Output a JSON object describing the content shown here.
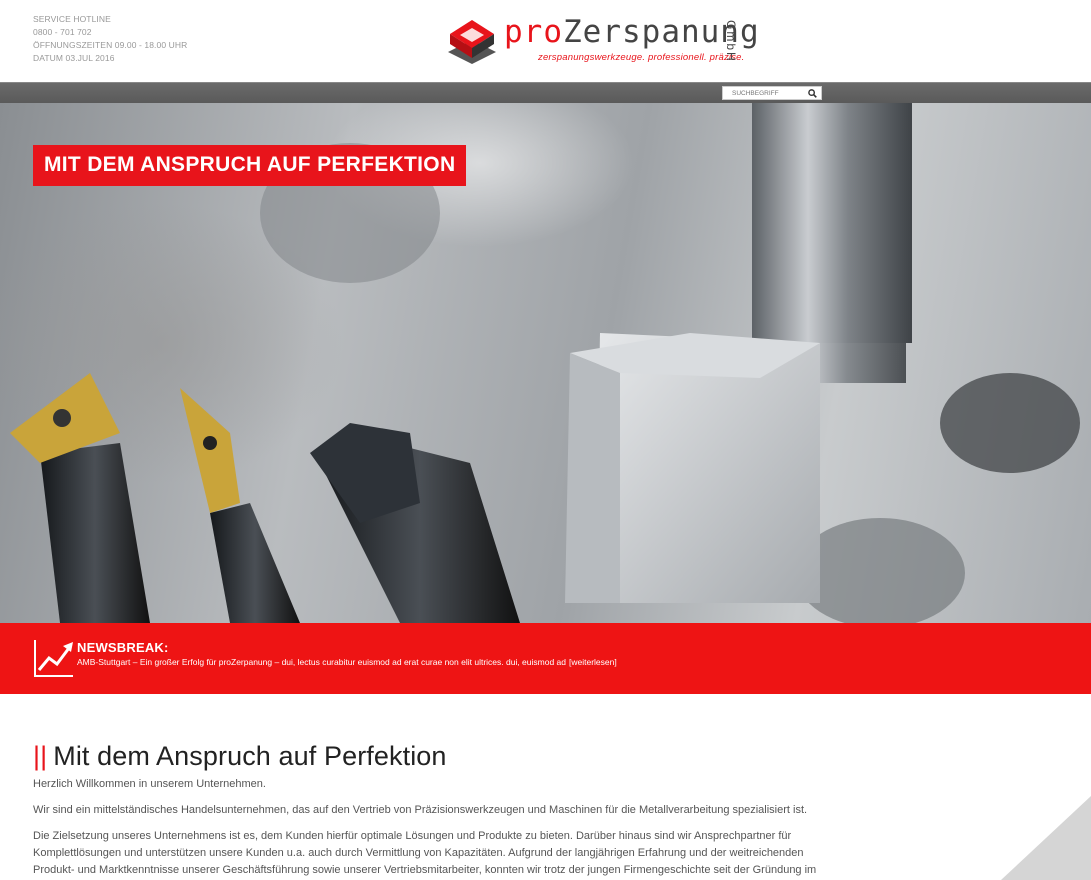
{
  "header": {
    "hotline_label": "SERVICE HOTLINE",
    "hotline_number": "0800 - 701 702",
    "opening_hours": "ÖFFNUNGSZEITEN 09.00 - 18.00 UHR",
    "date": "DATUM 03.JUL 2016",
    "logo": {
      "brand_prefix": "pro",
      "brand_name": "Zerspanung",
      "legal_form": "GmbH",
      "tagline": "zerspanungswerkzeuge. professionell. präzise."
    }
  },
  "search": {
    "placeholder": "SUCHBEGRIFF",
    "icon": "search-icon"
  },
  "hero": {
    "title": "MIT DEM ANSPRUCH AUF PERFEKTION"
  },
  "newsbreak": {
    "label": "NEWSBREAK:",
    "text": "AMB-Stuttgart – Ein großer Erfolg für proZerpanung – dui, lectus curabitur euismod ad erat curae non elit ultrices. dui, euismod ad",
    "more_link": "[weiterlesen]",
    "icon": "trend-chart-icon"
  },
  "content": {
    "bars": "||",
    "heading": "Mit dem Anspruch auf Perfektion",
    "paragraphs": [
      "Herzlich Willkommen in unserem Unternehmen.",
      "Wir sind ein mittelständisches Handelsunternehmen, das auf den Vertrieb von Präzisionswerkzeugen und Maschinen für die Metallverarbeitung spezialisiert ist.",
      "Die Zielsetzung unseres Unternehmens ist es, dem Kunden hierfür optimale Lösungen und Produkte zu bieten. Darüber hinaus sind wir Ansprechpartner für Komplettlösungen und unterstützen unsere Kunden u.a. auch durch Vermittlung von Kapazitäten. Aufgrund der langjährigen Erfahrung und der weitreichenden Produkt- und Marktkenntnisse unserer Geschäftsführung sowie unserer Vertriebsmitarbeiter, konnten wir trotz der jungen Firmengeschichte seit der Gründung im"
    ]
  },
  "colors": {
    "accent": "#e8141b",
    "bar_gray": "#5f5f5f"
  }
}
